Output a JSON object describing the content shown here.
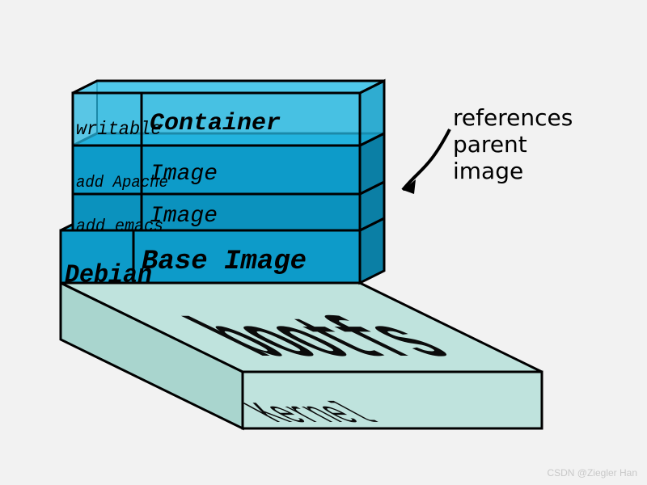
{
  "layers": {
    "kernel_big": "bootfs",
    "kernel_small": "Kernel",
    "base_left": "Debian",
    "base_right": "Base Image",
    "img2_left": "add emacs",
    "img2_right": "Image",
    "img1_left": "add Apache",
    "img1_right": "Image",
    "top_left": "writable",
    "top_right": "Container"
  },
  "annotation": {
    "line1": "references",
    "line2": "parent",
    "line3": "image"
  },
  "watermark": "CSDN @Ziegler Han",
  "colors": {
    "bg": "#f2f2f2",
    "kernel_fill": "#bfe3dd",
    "blue_a": "#0d9bc9",
    "blue_b": "#0b92be",
    "top_fill": "#25b7e0",
    "stroke": "#000000"
  }
}
